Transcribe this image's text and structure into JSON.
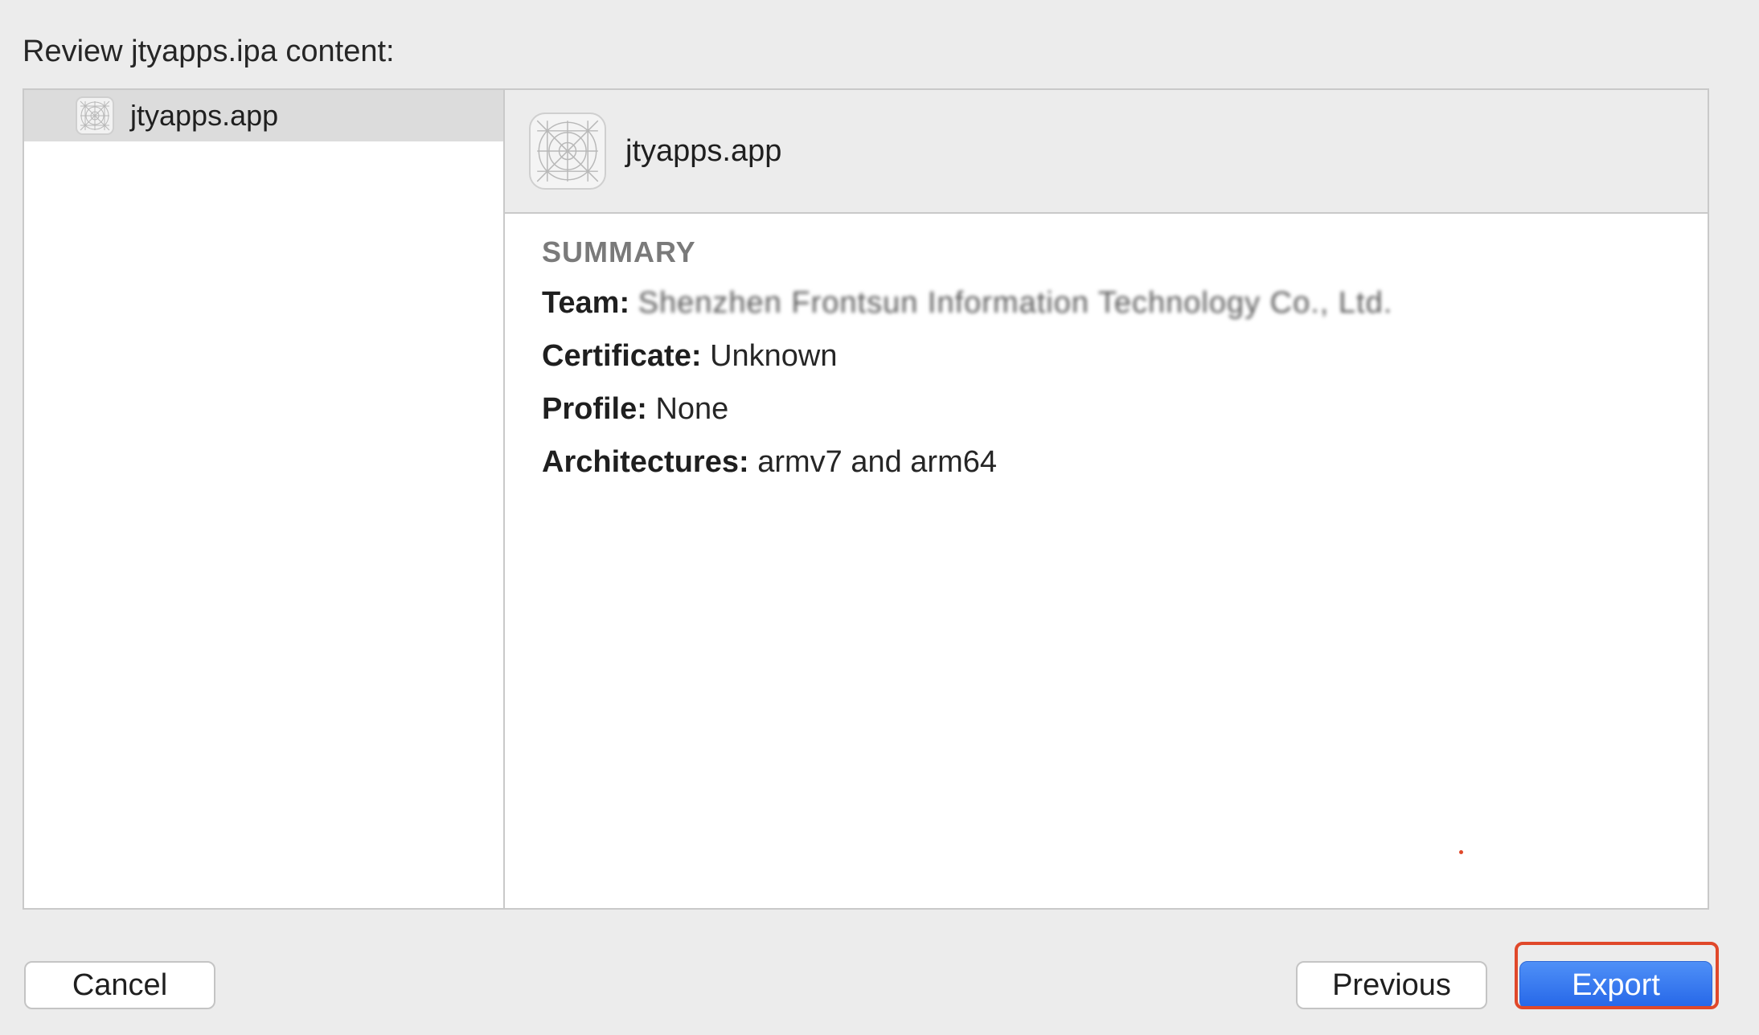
{
  "dialog": {
    "heading": "Review jtyapps.ipa content:"
  },
  "sidebar": {
    "items": [
      {
        "label": "jtyapps.app",
        "icon": "app-placeholder-icon"
      }
    ]
  },
  "detail": {
    "header_title": "jtyapps.app",
    "header_icon": "app-placeholder-icon",
    "summary_heading": "SUMMARY",
    "team_key": "Team:",
    "team_value": "Shenzhen Frontsun Information Technology Co., Ltd.",
    "certificate_key": "Certificate:",
    "certificate_value": "Unknown",
    "profile_key": "Profile:",
    "profile_value": "None",
    "architectures_key": "Architectures:",
    "architectures_value": "armv7 and arm64"
  },
  "buttons": {
    "cancel": "Cancel",
    "previous": "Previous",
    "export": "Export"
  },
  "colors": {
    "accent": "#2f6ff0",
    "highlight": "#e0482a"
  }
}
